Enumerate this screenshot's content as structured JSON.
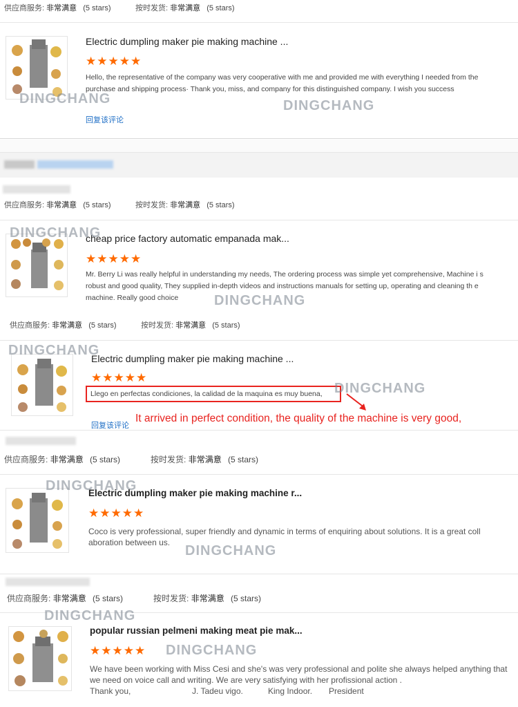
{
  "ratings": {
    "supplier_label": "供应商服务:",
    "supplier_value": "非常满意",
    "ship_label": "按时发货:",
    "ship_value": "非常满意",
    "stars_text": "(5 stars)"
  },
  "stars": "★★★★★",
  "watermark": "DINGCHANG",
  "reply_label": "回复该评论",
  "reviews": [
    {
      "title": "Electric dumpling maker pie making machine ...",
      "text": "Hello, the representative of the company was very cooperative with me and provided me with everything I needed from the purchase and shipping process· Thank you, miss, and company for this distinguished company. I wish you success"
    },
    {
      "title": "cheap price factory automatic empanada mak...",
      "text": "Mr. Berry Li was really helpful in understanding my needs, The ordering process was simple yet comprehensive, Machine i s robust and good quality, They supplied in-depth videos and instructions manuals for setting up, operating and cleaning th e machine.  Really good choice"
    },
    {
      "title": "Electric dumpling maker pie making machine ...",
      "text": "Llego en perfectas condiciones, la calidad de la maquina es muy buena,",
      "translation": "It arrived in perfect condition, the quality of the machine is very good,"
    },
    {
      "title": "Electric dumpling maker pie making machine r...",
      "text": "Coco is very professional, super friendly and dynamic in terms of enquiring about solutions. It is a great coll aboration between us."
    },
    {
      "title": "popular russian pelmeni making meat pie mak...",
      "text": "We have been working with Miss Cesi and she's was very professional and polite she always helped anything that we need on voice call and writing. We are very satisfying with her profissional action .",
      "signature": [
        "Thank you,",
        "J. Tadeu vigo.",
        "King Indoor.",
        "President"
      ]
    }
  ],
  "colors": {
    "star": "#ff6a00",
    "link": "#1f6fc6",
    "annotation": "#e8231f"
  }
}
